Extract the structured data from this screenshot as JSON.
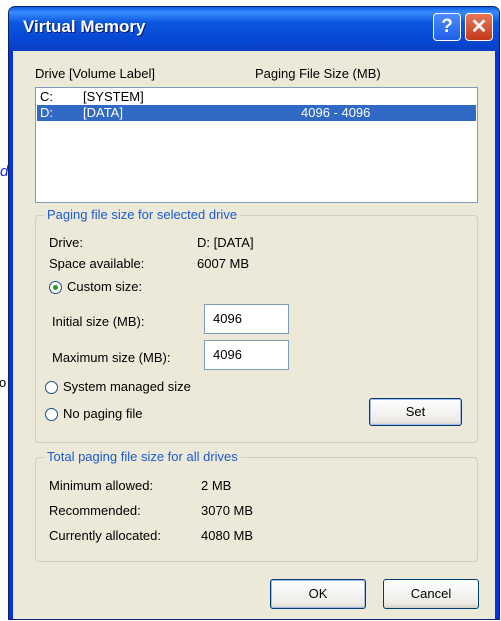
{
  "background": {
    "fragment_1": "d",
    "fragment_2": "o"
  },
  "window": {
    "title": "Virtual Memory",
    "help_label": "?",
    "close_label": "✕"
  },
  "list": {
    "col_drive": "Drive  [Volume Label]",
    "col_size": "Paging File Size (MB)",
    "rows": [
      {
        "drive": "C:",
        "label": "[SYSTEM]",
        "size": "",
        "selected": false
      },
      {
        "drive": "D:",
        "label": "[DATA]",
        "size": "4096 - 4096",
        "selected": true
      }
    ]
  },
  "selected_group": {
    "title": "Paging file size for selected drive",
    "drive_label": "Drive:",
    "drive_value": "D:  [DATA]",
    "space_label": "Space available:",
    "space_value": "6007 MB",
    "custom_label": "Custom size:",
    "initial_label": "Initial size (MB):",
    "initial_value": "4096",
    "max_label": "Maximum size (MB):",
    "max_value": "4096",
    "system_label": "System managed size",
    "nopage_label": "No paging file",
    "selected_option": "custom",
    "set_label": "Set"
  },
  "total_group": {
    "title": "Total paging file size for all drives",
    "min_label": "Minimum allowed:",
    "min_value": "2 MB",
    "rec_label": "Recommended:",
    "rec_value": "3070 MB",
    "alloc_label": "Currently allocated:",
    "alloc_value": "4080 MB"
  },
  "buttons": {
    "ok": "OK",
    "cancel": "Cancel"
  },
  "colors": {
    "title_bar": "#0b58e0",
    "selection": "#316ac5",
    "group_title": "#1d5ad0",
    "dialog_bg": "#ece9d8"
  }
}
